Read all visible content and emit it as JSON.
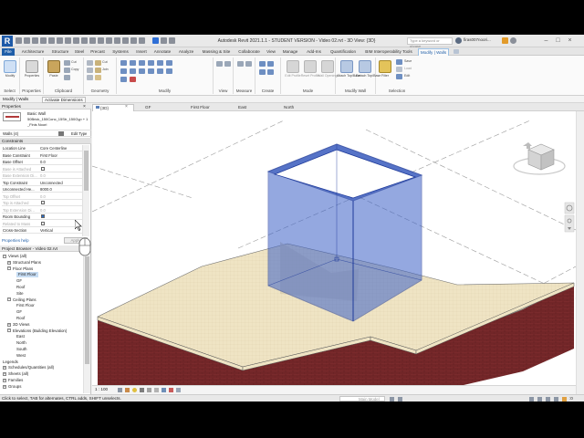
{
  "app": {
    "window_title": "Autodesk Revit 2021.1.1 - STUDENT VERSION - Video 02.rvt - 3D View: {3D}",
    "search_placeholder": "Type a keyword or phrase",
    "user": "firas007noori..."
  },
  "ribbon_tabs": [
    "File",
    "Architecture",
    "Structure",
    "Steel",
    "Precast",
    "Systems",
    "Insert",
    "Annotate",
    "Analyze",
    "Massing & Site",
    "Collaborate",
    "View",
    "Manage",
    "Add-Ins",
    "Quantification",
    "BIM Interoperability Tools",
    "Modify | Walls"
  ],
  "ribbon": {
    "select": "Select",
    "properties": "Properties",
    "clipboard": "Clipboard",
    "geometry": "Geometry",
    "modify": "Modify",
    "view": "View",
    "measure": "Measure",
    "create": "Create",
    "mode": "Mode",
    "modify_wall": "Modify Wall",
    "selection": "Selection",
    "btn_modify": "Modify",
    "btn_paste": "Paste",
    "btn_cut": "Cut",
    "btn_join": "Join",
    "btn_copy": "Copy",
    "btn_edit_profile": "Edit Profile",
    "btn_reset_profile": "Reset Profile",
    "btn_wall_opening": "Wall Opening",
    "btn_attach": "Attach Top/Base",
    "btn_detach": "Detach Top/Base",
    "btn_filter": "Filter",
    "btn_save": "Save",
    "btn_load": "Load",
    "btn_edit": "Edit"
  },
  "context_bar": {
    "label": "Modify | Walls",
    "activate_dimensions": "Activate Dimensions"
  },
  "properties": {
    "title": "Properties",
    "type_family": "Basic Wall",
    "type_name": "50Brick_150Conc_15Str_150Gyp + 12 Plaster Walls",
    "finish": "_Finis Noori",
    "selector": "Walls (4)",
    "edit_type": "Edit Type",
    "section": "Constraints",
    "rows": [
      {
        "k": "Location Line",
        "v": "Core Centerline",
        "dim": false
      },
      {
        "k": "Base Constraint",
        "v": "First Floor",
        "dim": false
      },
      {
        "k": "Base Offset",
        "v": "0.0",
        "dim": false
      },
      {
        "k": "Base is Attached",
        "v": "",
        "dim": true
      },
      {
        "k": "Base Extension Di...",
        "v": "0.0",
        "dim": true
      },
      {
        "k": "Top Constraint",
        "v": "Unconnected",
        "dim": false
      },
      {
        "k": "Unconnected He...",
        "v": "8000.0",
        "dim": false
      },
      {
        "k": "Top Offset",
        "v": "0.0",
        "dim": true
      },
      {
        "k": "Top is Attached",
        "v": "",
        "dim": true
      },
      {
        "k": "Top Extension Di...",
        "v": "0.0",
        "dim": true
      },
      {
        "k": "Room Bounding",
        "v": "",
        "dim": false
      },
      {
        "k": "Related to Mass",
        "v": "",
        "dim": true
      },
      {
        "k": "Cross-Section",
        "v": "Vertical",
        "dim": false
      }
    ],
    "help": "Properties help",
    "apply": "Apply"
  },
  "browser": {
    "title": "Project Browser - Video 02.rvt",
    "nodes": [
      {
        "label": "Views (all)",
        "indent": 0,
        "exp": "-",
        "sel": false
      },
      {
        "label": "Structural Plans",
        "indent": 1,
        "exp": "+",
        "sel": false
      },
      {
        "label": "Floor Plans",
        "indent": 1,
        "exp": "-",
        "sel": false
      },
      {
        "label": "First Floor",
        "indent": 3,
        "exp": "",
        "sel": true
      },
      {
        "label": "GF",
        "indent": 3,
        "exp": "",
        "sel": false
      },
      {
        "label": "Roof",
        "indent": 3,
        "exp": "",
        "sel": false
      },
      {
        "label": "Site",
        "indent": 3,
        "exp": "",
        "sel": false
      },
      {
        "label": "Ceiling Plans",
        "indent": 1,
        "exp": "-",
        "sel": false
      },
      {
        "label": "First Floor",
        "indent": 3,
        "exp": "",
        "sel": false
      },
      {
        "label": "GF",
        "indent": 3,
        "exp": "",
        "sel": false
      },
      {
        "label": "Roof",
        "indent": 3,
        "exp": "",
        "sel": false
      },
      {
        "label": "3D Views",
        "indent": 1,
        "exp": "+",
        "sel": false
      },
      {
        "label": "Elevations (Building Elevation)",
        "indent": 1,
        "exp": "-",
        "sel": false
      },
      {
        "label": "East",
        "indent": 3,
        "exp": "",
        "sel": false
      },
      {
        "label": "North",
        "indent": 3,
        "exp": "",
        "sel": false
      },
      {
        "label": "South",
        "indent": 3,
        "exp": "",
        "sel": false
      },
      {
        "label": "West",
        "indent": 3,
        "exp": "",
        "sel": false
      },
      {
        "label": "Legends",
        "indent": 0,
        "exp": "",
        "sel": false
      },
      {
        "label": "Schedules/Quantities (all)",
        "indent": 0,
        "exp": "+",
        "sel": false
      },
      {
        "label": "Sheets (all)",
        "indent": 0,
        "exp": "+",
        "sel": false
      },
      {
        "label": "Families",
        "indent": 0,
        "exp": "+",
        "sel": false
      },
      {
        "label": "Groups",
        "indent": 0,
        "exp": "+",
        "sel": false
      }
    ]
  },
  "view_tabs": [
    "{3D}",
    "GF",
    "First Floor",
    "East",
    "North"
  ],
  "viewport": {
    "scale": "1 : 100",
    "model": "Main Model"
  },
  "status_bar": {
    "hint": "Click to select, TAB for alternates, CTRL adds, SHIFT unselects.",
    "selection_count": ":0"
  },
  "colors": {
    "selection_blue": "#3d62c8",
    "floor_fill": "#efe4c4",
    "brick": "#7a2a2c",
    "ribbon_accent": "#1f5ea8"
  }
}
